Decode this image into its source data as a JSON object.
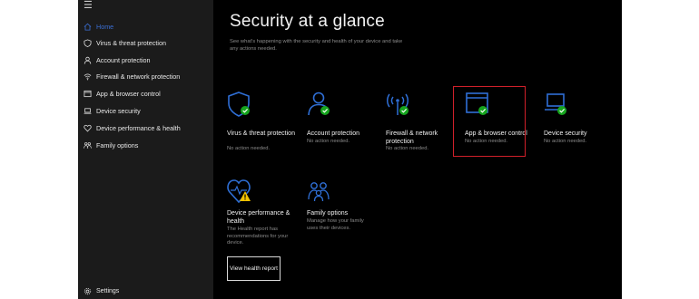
{
  "sidebar": {
    "menu_icon": "hamburger-icon",
    "items": [
      {
        "label": "Home",
        "icon": "home-icon",
        "active": true
      },
      {
        "label": "Virus & threat protection",
        "icon": "shield-icon"
      },
      {
        "label": "Account protection",
        "icon": "person-icon"
      },
      {
        "label": "Firewall & network protection",
        "icon": "wifi-icon"
      },
      {
        "label": "App & browser control",
        "icon": "app-window-icon"
      },
      {
        "label": "Device security",
        "icon": "laptop-icon"
      },
      {
        "label": "Device performance & health",
        "icon": "heart-icon"
      },
      {
        "label": "Family options",
        "icon": "family-icon"
      }
    ],
    "settings_label": "Settings",
    "settings_icon": "gear-icon"
  },
  "main": {
    "title": "Security at a glance",
    "subtitle": "See what's happening with the security and health of your device and take any actions needed."
  },
  "tiles": [
    {
      "name": "Virus & threat protection",
      "status": "No action needed.",
      "icon": "shield-icon",
      "badge": "check"
    },
    {
      "name": "Account protection",
      "status": "No action needed.",
      "icon": "person-icon",
      "badge": "check"
    },
    {
      "name": "Firewall & network protection",
      "status": "No action needed.",
      "icon": "wifi-icon",
      "badge": "check"
    },
    {
      "name": "App & browser control",
      "status": "No action needed.",
      "icon": "app-window-icon",
      "badge": "check"
    },
    {
      "name": "Device security",
      "status": "No action needed.",
      "icon": "laptop-icon",
      "badge": "check",
      "highlighted": true
    },
    {
      "name": "Device performance & health",
      "status": "The Health report has recommendations for your device.",
      "icon": "heart-icon",
      "badge": "warning",
      "button_label": "View health report"
    },
    {
      "name": "Family options",
      "status": "Manage how your family uses their devices.",
      "icon": "family-icon"
    }
  ],
  "colors": {
    "accent": "#2f6fd6",
    "ok": "#16a51e",
    "warn": "#f2c200",
    "highlight": "#d0202a"
  }
}
